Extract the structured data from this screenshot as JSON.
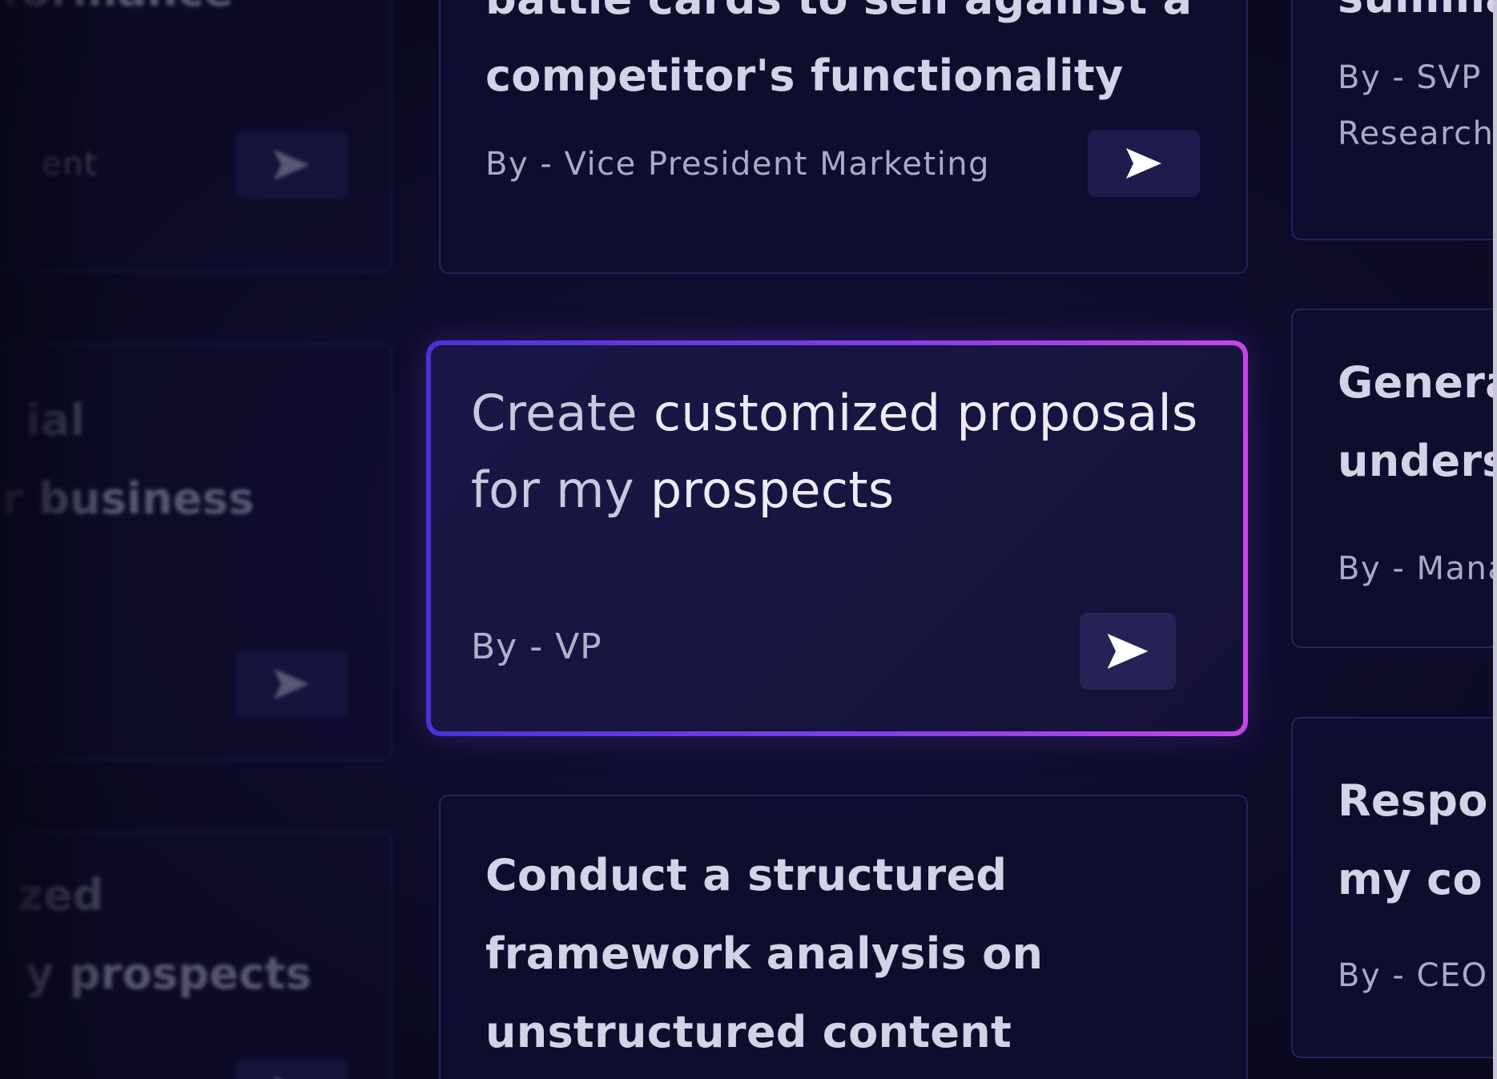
{
  "cards": {
    "left_top": {
      "title_lines": [
        "formance"
      ],
      "author": "ent"
    },
    "left_mid": {
      "title_lines": [
        "ial",
        "r business"
      ]
    },
    "left_bottom": {
      "title_lines": [
        "zed",
        "y prospects"
      ]
    },
    "center_top": {
      "title_lines": [
        "battle cards to sell against a",
        "competitor's functionality"
      ],
      "author": "By - Vice President Marketing"
    },
    "featured": {
      "title_lead": "Create ",
      "title_rest_line1": "customized proposals",
      "title_line2_lead": "for my ",
      "title_line2_rest": "prospects",
      "author": "By - VP"
    },
    "center_bottom": {
      "title_lines": [
        "Conduct a structured",
        "framework analysis on",
        "unstructured content"
      ]
    },
    "right_top": {
      "title_lines": [
        "summa"
      ],
      "author_lines": [
        "By - SVP",
        "Research"
      ]
    },
    "right_mid": {
      "title_lines": [
        "Genera",
        "unders"
      ],
      "author": "By - Mana"
    },
    "right_bottom": {
      "title_lines": [
        "Respo",
        "my co"
      ],
      "author": "By - CEO"
    }
  },
  "icons": {
    "send": "send-arrow-icon"
  },
  "colors": {
    "background": "#0b0a23",
    "card": "#0f0d2e",
    "card_border": "#25235a",
    "accent_gradient_start": "#4a32d8",
    "accent_gradient_end": "#c545e6"
  }
}
